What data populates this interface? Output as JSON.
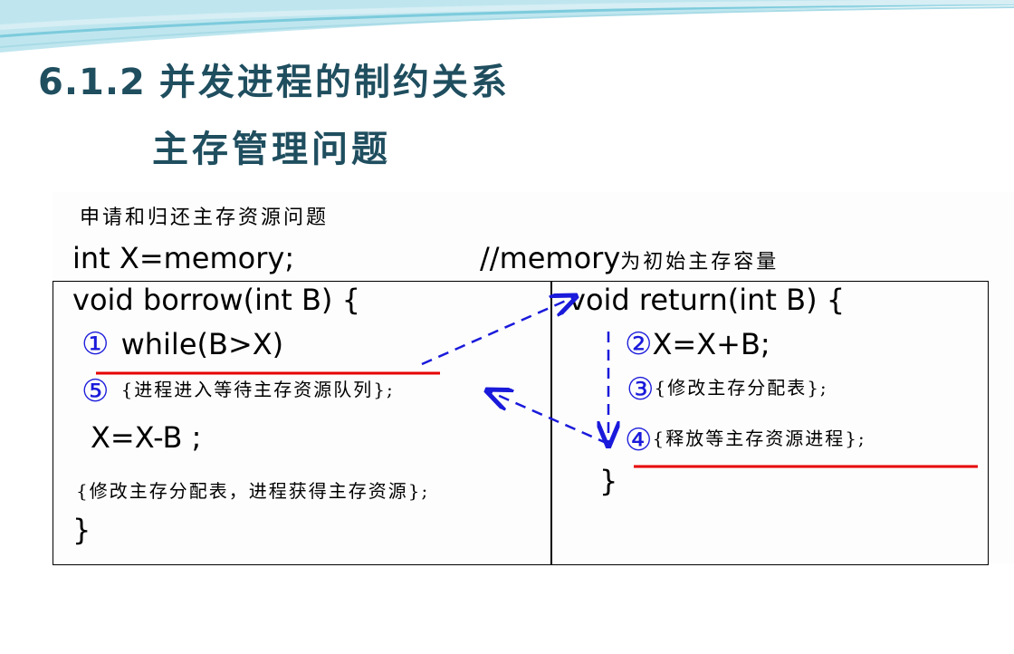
{
  "title": {
    "number": "6.1.2",
    "heading": "并发进程的制约关系",
    "subheading": "主存管理问题"
  },
  "content": {
    "intro": "申请和归还主存资源问题",
    "decl_code": "int X=memory;",
    "decl_comment_code": "//memory",
    "decl_comment_cn": "为初始主存容量",
    "borrow": {
      "header": "void borrow(int B) {",
      "step1_marker": "①",
      "step1_code": "while(B>X)",
      "step5_marker": "⑤",
      "step5_text": "{进程进入等待主存资源队列};",
      "sub_code": "X=X-B ;",
      "modify_text": "{修改主存分配表，进程获得主存资源};",
      "close": "}"
    },
    "return": {
      "header": "void return(int B) {",
      "step2_marker": "②",
      "step2_code": "X=X+B;",
      "step3_marker": "③",
      "step3_text": "{修改主存分配表};",
      "step4_marker": "④",
      "step4_text": "{释放等主存资源进程};",
      "close": "}"
    }
  },
  "colors": {
    "title": "#1f4e5f",
    "marker": "#1a1adb",
    "underline": "#e60000",
    "arrow": "#1a1adb"
  }
}
